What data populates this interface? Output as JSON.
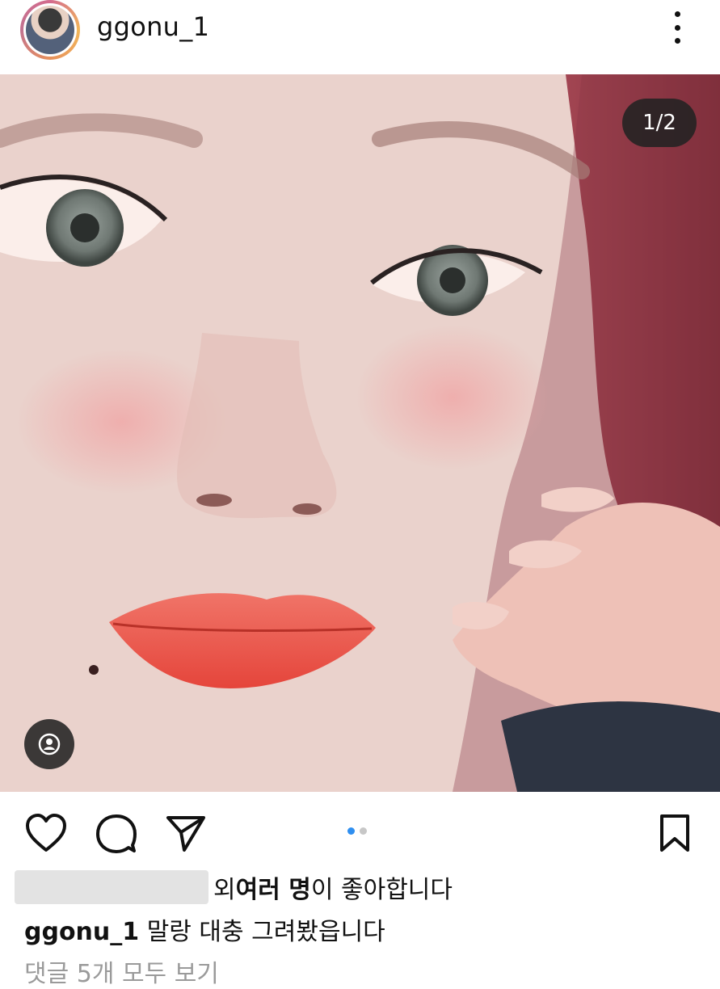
{
  "post": {
    "username": "ggonu_1",
    "image_counter": "1/2",
    "likes": {
      "suffix_plain": "외 ",
      "suffix_bold": "여러 명",
      "suffix_end": "이 좋아합니다"
    },
    "caption": {
      "username": "ggonu_1",
      "text": " 말랑 대충 그려봤읍니다"
    },
    "view_comments": "댓글 5개 모두 보기"
  },
  "carousel": {
    "current": 1,
    "total": 2
  },
  "colors": {
    "accent_blue": "#2f8ff0",
    "text": "#111111",
    "muted": "#9a9a9a"
  },
  "icons": [
    "more-options-icon",
    "user-tag-icon",
    "heart-icon",
    "comment-icon",
    "share-icon",
    "bookmark-icon"
  ]
}
